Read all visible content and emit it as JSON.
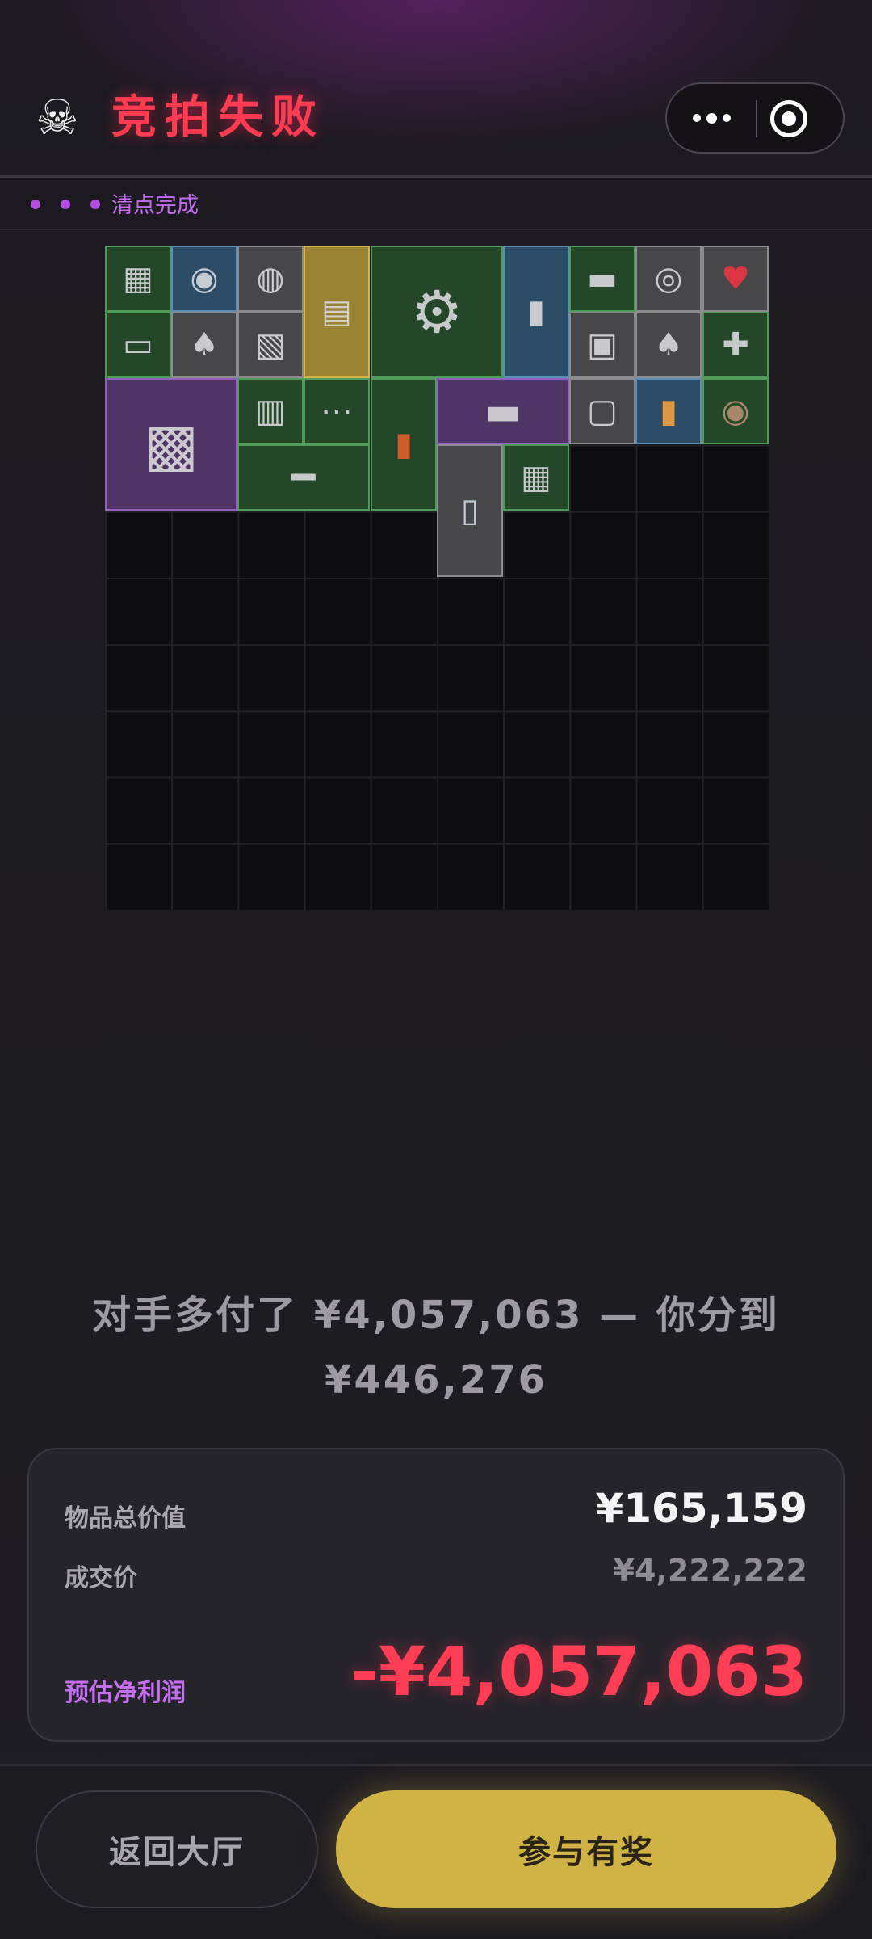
{
  "header": {
    "icon": "skull-icon",
    "title": "竞拍失败",
    "title_color": "#ff3b52"
  },
  "status": {
    "text": "清点完成",
    "accent": "#c36cf2"
  },
  "inventory": {
    "items": [
      {
        "name": "cpu-cooler",
        "rarity": "green"
      },
      {
        "name": "silver-coin",
        "rarity": "blue"
      },
      {
        "name": "tape-measure",
        "rarity": "gray"
      },
      {
        "name": "bank-notes",
        "rarity": "gold"
      },
      {
        "name": "angle-grinder",
        "rarity": "green"
      },
      {
        "name": "brass-telescope",
        "rarity": "blue"
      },
      {
        "name": "capacitor",
        "rarity": "green"
      },
      {
        "name": "duct-tape",
        "rarity": "gray"
      },
      {
        "name": "playing-card",
        "rarity": "gray"
      },
      {
        "name": "hard-drive",
        "rarity": "green"
      },
      {
        "name": "playing-card",
        "rarity": "gray"
      },
      {
        "name": "matchbox",
        "rarity": "gray"
      },
      {
        "name": "protein-jar",
        "rarity": "gray"
      },
      {
        "name": "playing-card",
        "rarity": "gray"
      },
      {
        "name": "wrench",
        "rarity": "green"
      },
      {
        "name": "motherboard",
        "rarity": "purple"
      },
      {
        "name": "battery-charger",
        "rarity": "green"
      },
      {
        "name": "power-strip",
        "rarity": "green"
      },
      {
        "name": "spirit-level",
        "rarity": "green"
      },
      {
        "name": "graphics-card",
        "rarity": "purple"
      },
      {
        "name": "photo-card",
        "rarity": "gray"
      },
      {
        "name": "pill-bottle",
        "rarity": "blue"
      },
      {
        "name": "bronze-coin",
        "rarity": "green"
      },
      {
        "name": "glass-tube",
        "rarity": "green"
      },
      {
        "name": "toothpaste",
        "rarity": "gray"
      },
      {
        "name": "cpu-cooler",
        "rarity": "green"
      }
    ]
  },
  "result": {
    "line1": "对手多付了 ¥4,057,063 — 你分到",
    "line2": "¥446,276"
  },
  "summary": {
    "total_label": "物品总价值",
    "total_value": "¥165,159",
    "deal_label": "成交价",
    "deal_value": "¥4,222,222",
    "profit_label": "预估净利润",
    "profit_value": "-¥4,057,063",
    "profit_color": "#ff3d55"
  },
  "actions": {
    "back_label": "返回大厅",
    "join_label": "参与有奖",
    "join_color": "#d1b244"
  }
}
